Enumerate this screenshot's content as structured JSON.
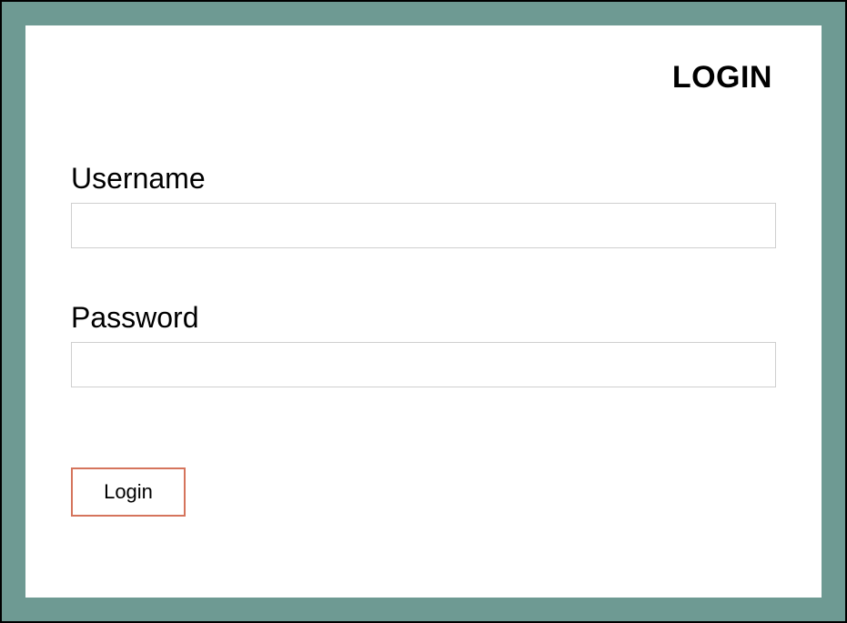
{
  "header": {
    "title": "LOGIN"
  },
  "form": {
    "username": {
      "label": "Username",
      "value": ""
    },
    "password": {
      "label": "Password",
      "value": ""
    },
    "submit": {
      "label": "Login"
    }
  },
  "colors": {
    "frame": "#6e9a93",
    "button_border": "#d5745c",
    "input_border": "#cfcfcf"
  }
}
